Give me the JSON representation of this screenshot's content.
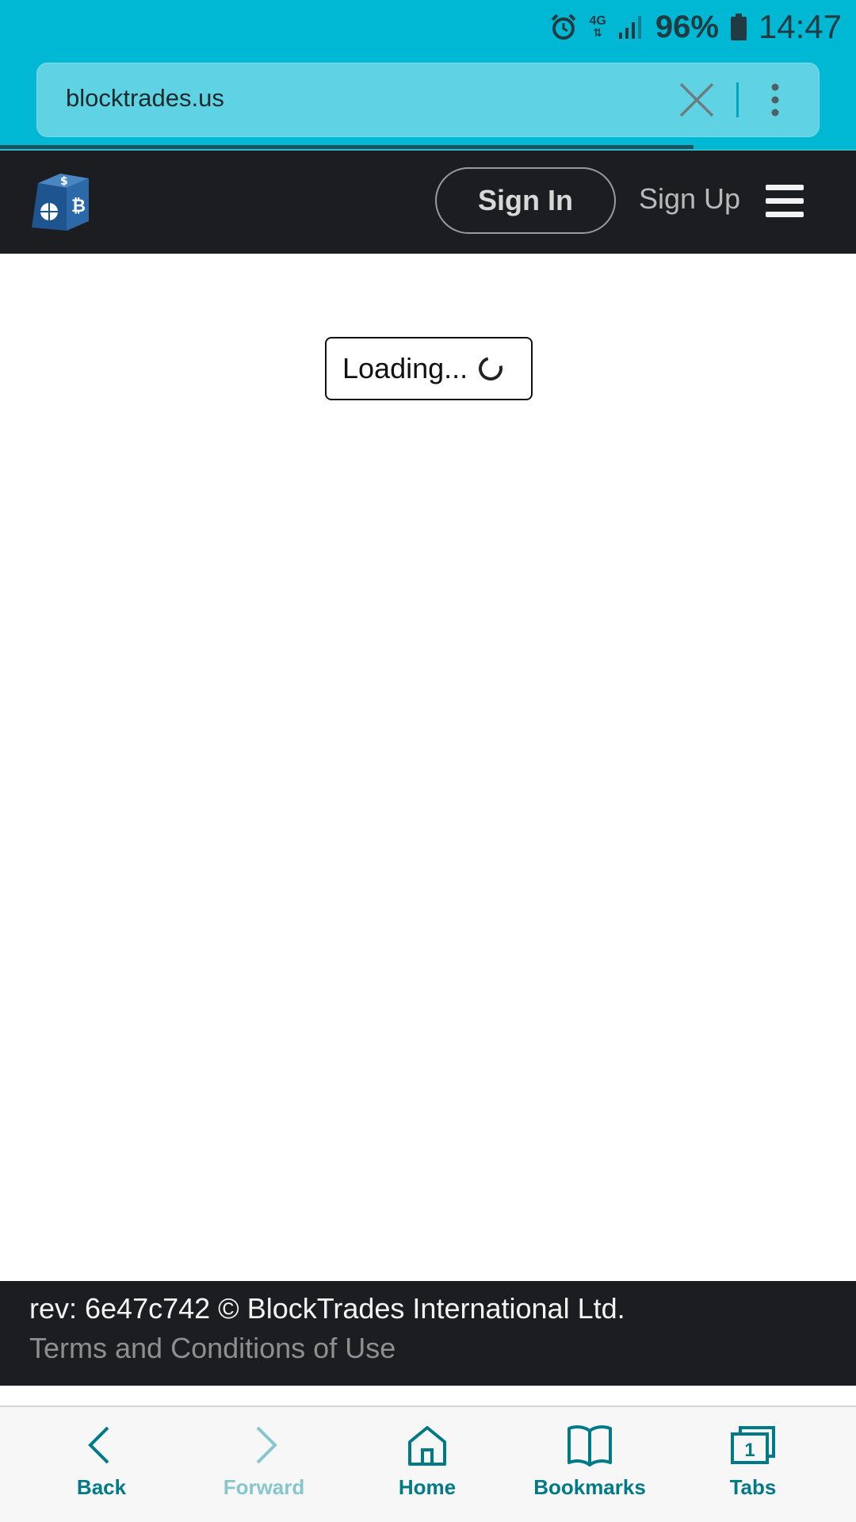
{
  "status_bar": {
    "network": "4G",
    "battery_percent": "96%",
    "time": "14:47"
  },
  "browser": {
    "url": "blocktrades.us",
    "load_progress": 0.81
  },
  "header": {
    "sign_in_label": "Sign In",
    "sign_up_label": "Sign Up"
  },
  "main": {
    "loading_text": "Loading..."
  },
  "footer": {
    "revision_text": "rev: 6e47c742 © BlockTrades International Ltd.",
    "terms_text": "Terms and Conditions of Use"
  },
  "bottom_nav": {
    "back": "Back",
    "forward": "Forward",
    "home": "Home",
    "bookmarks": "Bookmarks",
    "tabs": "Tabs",
    "tab_count": "1"
  },
  "colors": {
    "chrome": "#00b8d4",
    "header_bg": "#1c1d20",
    "nav_accent": "#007a86"
  }
}
